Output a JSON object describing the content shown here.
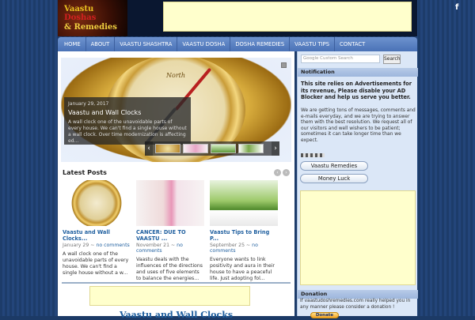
{
  "header": {
    "logo_line1": "Vaastu ",
    "logo_line1b": "Doshas",
    "logo_line2": "& Remedies",
    "social_icon": "facebook-icon",
    "social_glyph": "f"
  },
  "nav": {
    "items": [
      "HOME",
      "ABOUT",
      "VAASTU SHASHTRA",
      "VAASTU DOSHA",
      "DOSHA REMEDIES",
      "VAASTU TIPS",
      "CONTACT"
    ]
  },
  "slider": {
    "compass_word": "North",
    "date": "January 29, 2017",
    "title": "Vaastu and Wall Clocks",
    "excerpt": "A wall clock one of the unavoidable parts of every house. We can't find a single house without a wall clock. Over time modernization is affecting ed...",
    "prev": "‹",
    "next": "›"
  },
  "latest": {
    "heading": "Latest Posts",
    "prev": "‹",
    "next": "›",
    "posts": [
      {
        "title": "Vaastu and Wall Clocks...",
        "date": "January 29",
        "sep": " ~ ",
        "comments": "no comments",
        "excerpt": "A wall clock one of the unavoidable parts of every house. We can't find a single house without a w..."
      },
      {
        "title": "CANCER: DUE TO VAASTU ...",
        "date": "November 21",
        "sep": " ~ ",
        "comments": "no comments",
        "excerpt": "Vaastu deals with the influences of the directions and uses of five elements to balance the energies..."
      },
      {
        "title": "Vaastu Tips to Bring P...",
        "date": "September 25",
        "sep": " ~ ",
        "comments": "no comments",
        "excerpt": "Everyone wants to link positivity and aura in their house to have a peaceful life. Just adopting fol..."
      }
    ]
  },
  "bottom_title": "Vaastu and Wall Clocks",
  "sidebar": {
    "search_placeholder": "Google Custom Search",
    "search_button": "Search",
    "notification_heading": "Notification",
    "notification_bold": "This site relies on Advertisements for its revenue, Please disable your AD Blocker and help us serve you better.",
    "notification_text": "We are getting tons of messages, comments and e-mails everyday, and we are trying to answer them with the best resolution. We request all of our visitors and well wishers to be patient; sometimes it can take longer time than we expect.",
    "buttons": [
      "Vaastu Remedies",
      "Money Luck"
    ],
    "donation_heading": "Donation",
    "donation_text": "If vaastudoshremedies.com really helped you in any manner please consider a donation !",
    "donate_button": "Donate"
  }
}
